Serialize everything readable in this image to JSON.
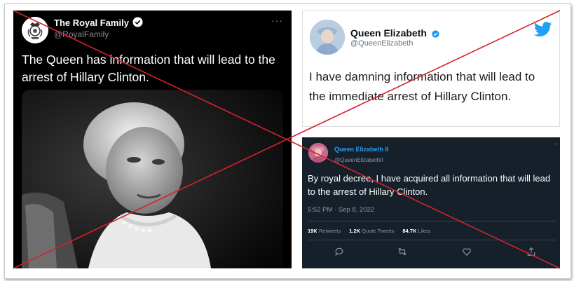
{
  "panel1": {
    "name": "The Royal Family",
    "handle": "@RoyalFamily",
    "more": "···",
    "text": "The Queen has information that will lead to the arrest of Hillary Clinton."
  },
  "panel2": {
    "name": "Queen Elizabeth",
    "handle": "@QueenElizabeth",
    "text": "I have damning information that will lead to the immediate arrest of Hillary Clinton."
  },
  "panel3": {
    "name": "Queen Elizabeth II",
    "handle": "@QueenElizabethII",
    "more": "··",
    "text": "By royal decree, I have acquired all information that will lead to the arrest of Hillary Clinton.",
    "time": "5:52 PM · Sep 8, 2022",
    "retweets_count": "19K",
    "retweets_label": "Retweets",
    "quotes_count": "1.2K",
    "quotes_label": "Quote Tweets",
    "likes_count": "84.7K",
    "likes_label": "Likes"
  },
  "colors": {
    "cross": "#d3232c",
    "verified": "#1d9bf0",
    "twitter_bird": "#1da1f2"
  },
  "icons": [
    "royal-crest-icon",
    "verified-badge-icon",
    "twitter-bird-icon",
    "reply-icon",
    "retweet-icon",
    "like-icon",
    "share-icon"
  ]
}
